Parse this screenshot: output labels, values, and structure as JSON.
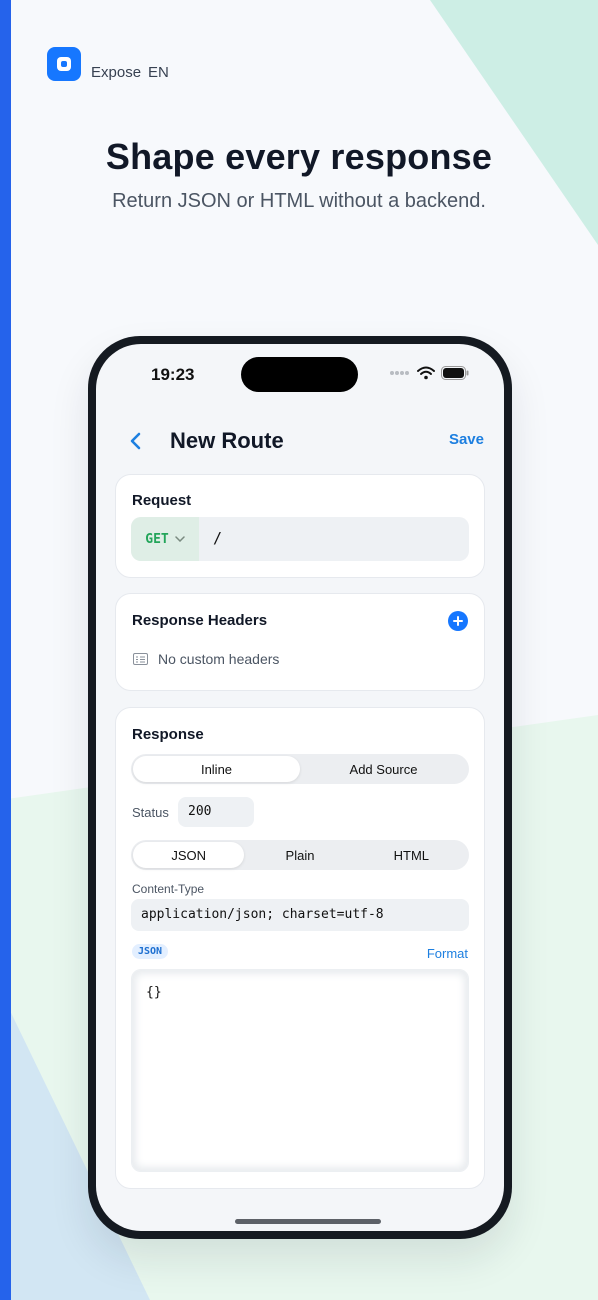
{
  "brand": {
    "name": "Expose",
    "lang": "EN"
  },
  "hero": {
    "headline": "Shape every response",
    "subline": "Return JSON or HTML without a backend."
  },
  "status_bar": {
    "time": "19:23"
  },
  "nav": {
    "title": "New Route",
    "save": "Save"
  },
  "request": {
    "title": "Request",
    "method": "GET",
    "path": "/"
  },
  "headers": {
    "title": "Response Headers",
    "empty": "No custom headers"
  },
  "response": {
    "title": "Response",
    "source_tabs": [
      {
        "label": "Inline",
        "active": true
      },
      {
        "label": "Add Source",
        "active": false
      }
    ],
    "status_label": "Status",
    "status_value": "200",
    "format_tabs": [
      {
        "label": "JSON",
        "active": true
      },
      {
        "label": "Plain",
        "active": false
      },
      {
        "label": "HTML",
        "active": false
      }
    ],
    "content_type_label": "Content-Type",
    "content_type_value": "application/json; charset=utf-8",
    "body_badge": "JSON",
    "format_link": "Format",
    "body": "{}"
  },
  "colors": {
    "accent": "#1677ff",
    "method_green": "#23a55a",
    "left_stripe": "#2563eb"
  }
}
